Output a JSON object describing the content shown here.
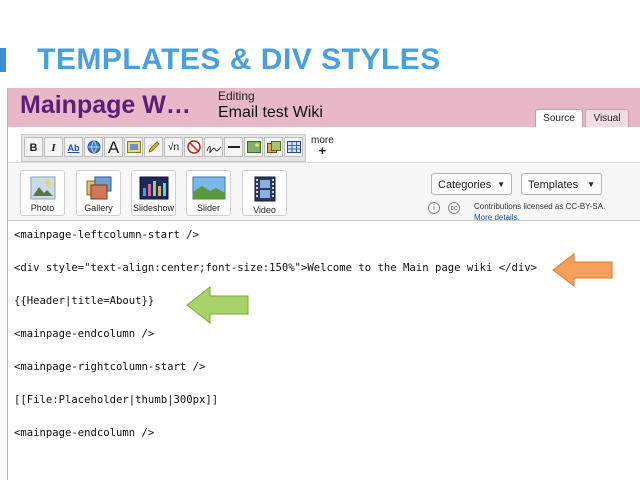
{
  "slide": {
    "title": "TEMPLATES & DIV STYLES"
  },
  "header": {
    "wiki_name": "Mainpage W…",
    "editing_label": "Editing",
    "page_name": "Email test Wiki"
  },
  "tabs": [
    {
      "label": "Source",
      "active": true
    },
    {
      "label": "Visual",
      "active": false
    }
  ],
  "toolbar": {
    "buttons": [
      "bold",
      "italic",
      "link",
      "globe-link",
      "big-text",
      "signature",
      "pencil",
      "formula",
      "no-wiki",
      "signature-pen",
      "horizontal-rule",
      "image",
      "gallery",
      "table"
    ],
    "bold_glyph": "B",
    "italic_glyph": "I",
    "link_glyph": "Ab",
    "big_glyph": "A",
    "more_label": "more",
    "more_plus": "+"
  },
  "media": [
    {
      "label": "Photo",
      "icon": "photo-icon"
    },
    {
      "label": "Gallery",
      "icon": "gallery-icon"
    },
    {
      "label": "Slideshow",
      "icon": "slideshow-icon"
    },
    {
      "label": "Slider",
      "icon": "slider-icon"
    },
    {
      "label": "Video",
      "icon": "video-icon"
    }
  ],
  "dropdowns": {
    "categories": "Categories",
    "templates": "Templates"
  },
  "license": {
    "line1": "Contributions licensed as CC-BY-SA.",
    "more": "More details."
  },
  "code_lines": [
    "<mainpage-leftcolumn-start />",
    "<div style=\"text-align:center;font-size:150%\">Welcome to the Main page wiki </div>",
    "{{Header|title=About}}",
    "<mainpage-endcolumn />",
    "<mainpage-rightcolumn-start />",
    "[[File:Placeholder|thumb|300px]]",
    "<mainpage-endcolumn />"
  ],
  "colors": {
    "title_blue": "#4a9fe0",
    "header_pink": "#e7b8c8",
    "wiki_purple": "#5a1f76",
    "arrow_orange": "#f5a05a",
    "arrow_green": "#a8d36a"
  }
}
